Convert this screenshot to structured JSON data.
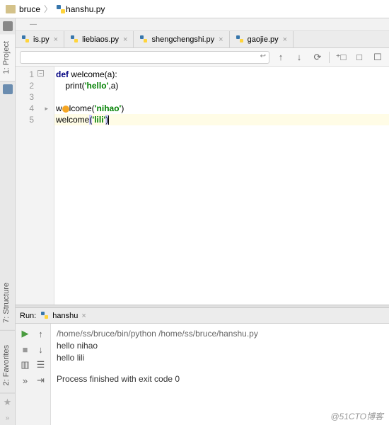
{
  "breadcrumb": {
    "folder": "bruce",
    "file": "hanshu.py"
  },
  "tabs": [
    {
      "label": "is.py"
    },
    {
      "label": "liebiaos.py"
    },
    {
      "label": "shengchengshi.py"
    },
    {
      "label": "gaojie.py"
    }
  ],
  "vtabs": {
    "project": "1: Project",
    "structure": "7: Structure",
    "favorites": "2: Favorites"
  },
  "search": {
    "placeholder": ""
  },
  "code": {
    "l1_kw": "def",
    "l1_rest": " welcome(a):",
    "l2a": "    print(",
    "l2s": "'hello'",
    "l2b": ",a)",
    "l4a": "w",
    "l4b": "lcome(",
    "l4s": "'nihao'",
    "l4c": ")",
    "l5a": "welcome",
    "l5p1": "(",
    "l5s": "'lili'",
    "l5p2": ")"
  },
  "line_numbers": [
    "1",
    "2",
    "3",
    "4",
    "5"
  ],
  "run": {
    "label": "Run:",
    "tab": "hanshu",
    "out1": "/home/ss/bruce/bin/python /home/ss/bruce/hanshu.py",
    "out2": "hello nihao",
    "out3": "hello lili",
    "out4": "Process finished with exit code 0"
  },
  "watermark": "@51CTO博客"
}
